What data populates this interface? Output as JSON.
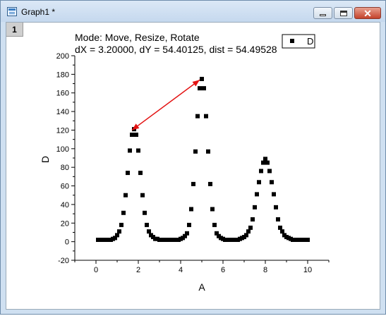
{
  "window": {
    "title": "Graph1 *",
    "layer_label": "1"
  },
  "overlay": {
    "mode_line": "Mode: Move, Resize, Rotate",
    "delta_line": "dX = 3.20000, dY = 54.40125, dist = 54.49528"
  },
  "colors": {
    "marker": "#000000",
    "arrow": "#e31212"
  },
  "chart_data": {
    "type": "scatter",
    "xlabel": "A",
    "ylabel": "D",
    "xlim": [
      -1,
      11
    ],
    "ylim": [
      -20,
      200
    ],
    "x_ticks": [
      0,
      2,
      4,
      6,
      8,
      10
    ],
    "y_ticks": [
      -20,
      0,
      20,
      40,
      60,
      80,
      100,
      120,
      140,
      160,
      180,
      200
    ],
    "legend": {
      "entries": [
        "D"
      ],
      "position": "top-right"
    },
    "series": [
      {
        "name": "D",
        "marker": "square",
        "x": [
          0.1,
          0.2,
          0.3,
          0.4,
          0.5,
          0.6,
          0.7,
          0.8,
          0.9,
          1.0,
          1.1,
          1.2,
          1.3,
          1.4,
          1.5,
          1.6,
          1.7,
          1.8,
          1.9,
          2.0,
          2.1,
          2.2,
          2.3,
          2.4,
          2.5,
          2.6,
          2.7,
          2.8,
          2.9,
          3.0,
          3.1,
          3.2,
          3.3,
          3.4,
          3.5,
          3.6,
          3.7,
          3.8,
          3.9,
          4.0,
          4.1,
          4.2,
          4.3,
          4.4,
          4.5,
          4.6,
          4.7,
          4.8,
          4.9,
          5.0,
          5.1,
          5.2,
          5.3,
          5.4,
          5.5,
          5.6,
          5.7,
          5.8,
          5.9,
          6.0,
          6.1,
          6.2,
          6.3,
          6.4,
          6.5,
          6.6,
          6.7,
          6.8,
          6.9,
          7.0,
          7.1,
          7.2,
          7.3,
          7.4,
          7.5,
          7.6,
          7.7,
          7.8,
          7.9,
          8.0,
          8.1,
          8.2,
          8.3,
          8.4,
          8.5,
          8.6,
          8.7,
          8.8,
          8.9,
          9.0,
          9.1,
          9.2,
          9.3,
          9.4,
          9.5,
          9.6,
          9.7,
          9.8,
          9.9,
          10.0
        ],
        "y": [
          2,
          2,
          2,
          2,
          2,
          2,
          2,
          3,
          4,
          7,
          11,
          18,
          31,
          50,
          74,
          98,
          115,
          121,
          115,
          98,
          74,
          50,
          31,
          18,
          11,
          7,
          5,
          3,
          3,
          2,
          2,
          2,
          2,
          2,
          2,
          2,
          2,
          2,
          2,
          3,
          4,
          6,
          9,
          18,
          35,
          62,
          97,
          135,
          165,
          175,
          165,
          135,
          97,
          62,
          35,
          18,
          9,
          6,
          4,
          3,
          2,
          2,
          2,
          2,
          2,
          2,
          2,
          3,
          4,
          5,
          7,
          11,
          15,
          24,
          37,
          51,
          64,
          76,
          85,
          89,
          85,
          76,
          64,
          51,
          37,
          24,
          15,
          11,
          7,
          5,
          4,
          3,
          2,
          2,
          2,
          2,
          2,
          2,
          2,
          2
        ]
      }
    ],
    "annotations": [
      {
        "type": "arrow",
        "from": [
          4.9,
          174
        ],
        "to": [
          1.7,
          120
        ]
      }
    ]
  }
}
